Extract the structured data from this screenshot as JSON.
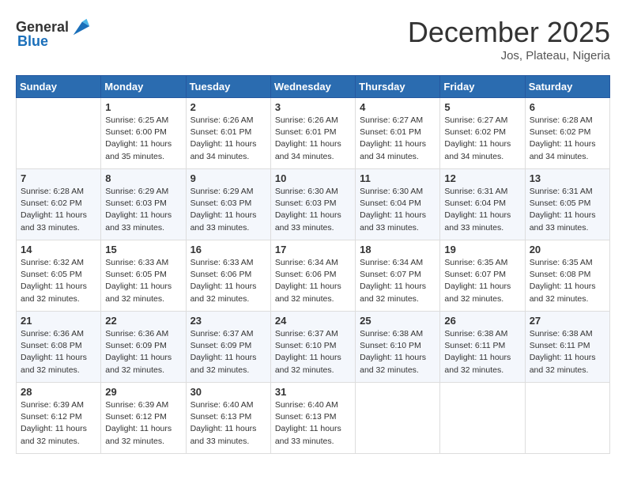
{
  "header": {
    "logo_general": "General",
    "logo_blue": "Blue",
    "month_year": "December 2025",
    "location": "Jos, Plateau, Nigeria"
  },
  "calendar": {
    "days_of_week": [
      "Sunday",
      "Monday",
      "Tuesday",
      "Wednesday",
      "Thursday",
      "Friday",
      "Saturday"
    ],
    "weeks": [
      [
        {
          "day": "",
          "info": ""
        },
        {
          "day": "1",
          "info": "Sunrise: 6:25 AM\nSunset: 6:00 PM\nDaylight: 11 hours\nand 35 minutes."
        },
        {
          "day": "2",
          "info": "Sunrise: 6:26 AM\nSunset: 6:01 PM\nDaylight: 11 hours\nand 34 minutes."
        },
        {
          "day": "3",
          "info": "Sunrise: 6:26 AM\nSunset: 6:01 PM\nDaylight: 11 hours\nand 34 minutes."
        },
        {
          "day": "4",
          "info": "Sunrise: 6:27 AM\nSunset: 6:01 PM\nDaylight: 11 hours\nand 34 minutes."
        },
        {
          "day": "5",
          "info": "Sunrise: 6:27 AM\nSunset: 6:02 PM\nDaylight: 11 hours\nand 34 minutes."
        },
        {
          "day": "6",
          "info": "Sunrise: 6:28 AM\nSunset: 6:02 PM\nDaylight: 11 hours\nand 34 minutes."
        }
      ],
      [
        {
          "day": "7",
          "info": "Sunrise: 6:28 AM\nSunset: 6:02 PM\nDaylight: 11 hours\nand 33 minutes."
        },
        {
          "day": "8",
          "info": "Sunrise: 6:29 AM\nSunset: 6:03 PM\nDaylight: 11 hours\nand 33 minutes."
        },
        {
          "day": "9",
          "info": "Sunrise: 6:29 AM\nSunset: 6:03 PM\nDaylight: 11 hours\nand 33 minutes."
        },
        {
          "day": "10",
          "info": "Sunrise: 6:30 AM\nSunset: 6:03 PM\nDaylight: 11 hours\nand 33 minutes."
        },
        {
          "day": "11",
          "info": "Sunrise: 6:30 AM\nSunset: 6:04 PM\nDaylight: 11 hours\nand 33 minutes."
        },
        {
          "day": "12",
          "info": "Sunrise: 6:31 AM\nSunset: 6:04 PM\nDaylight: 11 hours\nand 33 minutes."
        },
        {
          "day": "13",
          "info": "Sunrise: 6:31 AM\nSunset: 6:05 PM\nDaylight: 11 hours\nand 33 minutes."
        }
      ],
      [
        {
          "day": "14",
          "info": "Sunrise: 6:32 AM\nSunset: 6:05 PM\nDaylight: 11 hours\nand 32 minutes."
        },
        {
          "day": "15",
          "info": "Sunrise: 6:33 AM\nSunset: 6:05 PM\nDaylight: 11 hours\nand 32 minutes."
        },
        {
          "day": "16",
          "info": "Sunrise: 6:33 AM\nSunset: 6:06 PM\nDaylight: 11 hours\nand 32 minutes."
        },
        {
          "day": "17",
          "info": "Sunrise: 6:34 AM\nSunset: 6:06 PM\nDaylight: 11 hours\nand 32 minutes."
        },
        {
          "day": "18",
          "info": "Sunrise: 6:34 AM\nSunset: 6:07 PM\nDaylight: 11 hours\nand 32 minutes."
        },
        {
          "day": "19",
          "info": "Sunrise: 6:35 AM\nSunset: 6:07 PM\nDaylight: 11 hours\nand 32 minutes."
        },
        {
          "day": "20",
          "info": "Sunrise: 6:35 AM\nSunset: 6:08 PM\nDaylight: 11 hours\nand 32 minutes."
        }
      ],
      [
        {
          "day": "21",
          "info": "Sunrise: 6:36 AM\nSunset: 6:08 PM\nDaylight: 11 hours\nand 32 minutes."
        },
        {
          "day": "22",
          "info": "Sunrise: 6:36 AM\nSunset: 6:09 PM\nDaylight: 11 hours\nand 32 minutes."
        },
        {
          "day": "23",
          "info": "Sunrise: 6:37 AM\nSunset: 6:09 PM\nDaylight: 11 hours\nand 32 minutes."
        },
        {
          "day": "24",
          "info": "Sunrise: 6:37 AM\nSunset: 6:10 PM\nDaylight: 11 hours\nand 32 minutes."
        },
        {
          "day": "25",
          "info": "Sunrise: 6:38 AM\nSunset: 6:10 PM\nDaylight: 11 hours\nand 32 minutes."
        },
        {
          "day": "26",
          "info": "Sunrise: 6:38 AM\nSunset: 6:11 PM\nDaylight: 11 hours\nand 32 minutes."
        },
        {
          "day": "27",
          "info": "Sunrise: 6:38 AM\nSunset: 6:11 PM\nDaylight: 11 hours\nand 32 minutes."
        }
      ],
      [
        {
          "day": "28",
          "info": "Sunrise: 6:39 AM\nSunset: 6:12 PM\nDaylight: 11 hours\nand 32 minutes."
        },
        {
          "day": "29",
          "info": "Sunrise: 6:39 AM\nSunset: 6:12 PM\nDaylight: 11 hours\nand 32 minutes."
        },
        {
          "day": "30",
          "info": "Sunrise: 6:40 AM\nSunset: 6:13 PM\nDaylight: 11 hours\nand 33 minutes."
        },
        {
          "day": "31",
          "info": "Sunrise: 6:40 AM\nSunset: 6:13 PM\nDaylight: 11 hours\nand 33 minutes."
        },
        {
          "day": "",
          "info": ""
        },
        {
          "day": "",
          "info": ""
        },
        {
          "day": "",
          "info": ""
        }
      ]
    ]
  }
}
